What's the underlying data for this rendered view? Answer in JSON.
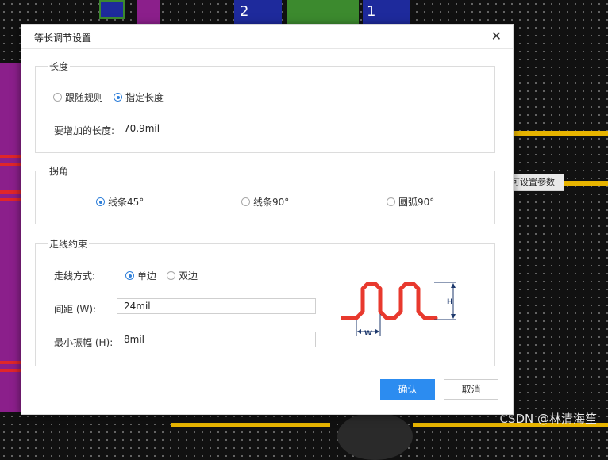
{
  "dialog": {
    "title": "等长调节设置",
    "close_icon": "close-icon"
  },
  "length_group": {
    "legend": "长度",
    "options": [
      "跟随规则",
      "指定长度"
    ],
    "selected": "指定长度",
    "add_length_label": "要增加的长度:",
    "add_length_value": "70.9mil"
  },
  "corner_group": {
    "legend": "拐角",
    "options": [
      "线条45°",
      "线条90°",
      "圆弧90°"
    ],
    "selected": "线条45°"
  },
  "routing_group": {
    "legend": "走线约束",
    "mode_label": "走线方式:",
    "mode_options": [
      "单边",
      "双边"
    ],
    "mode_selected": "单边",
    "spacing_label": "间距 (W):",
    "spacing_value": "24mil",
    "amplitude_label": "最小振幅 (H):",
    "amplitude_value": "8mil",
    "diagram": {
      "w_label": "W",
      "h_label": "H",
      "trace_color": "#e8392e",
      "dim_color": "#1f3a6e"
    }
  },
  "buttons": {
    "ok": "确认",
    "cancel": "取消"
  },
  "background": {
    "tooltip": "可设置参数",
    "watermark": "CSDN @林清海笙",
    "pad_labels": [
      "2",
      "1"
    ]
  },
  "colors": {
    "accent": "#2c8cf0",
    "board": "#111111",
    "copper": "#e7b400",
    "via_purple": "#8b1f8b"
  }
}
